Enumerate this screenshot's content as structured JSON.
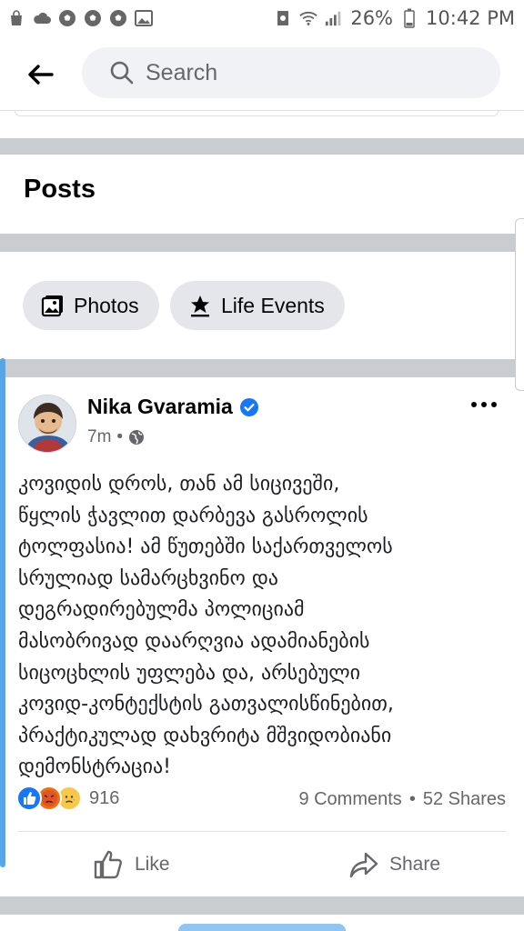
{
  "status_bar": {
    "battery": "26%",
    "time": "10:42 PM"
  },
  "header": {
    "search_placeholder": "Search"
  },
  "section": {
    "title": "Posts"
  },
  "chips": [
    {
      "label": "Photos",
      "icon": "photos-icon"
    },
    {
      "label": "Life Events",
      "icon": "star-flag-icon"
    }
  ],
  "post": {
    "author": "Nika Gvaramia",
    "time": "7m",
    "separator": "•",
    "text_lines": [
      "კოვიდის დროს, თან ამ სიცივეში,",
      "წყლის ჭავლით დარბევა გასროლის",
      "ტოლფასია! ამ წუთებში საქართველოს",
      "სრულიად სამარცხვინო და",
      "დეგრადირებულმა პოლიციამ",
      "მასობრივად დაარღვია ადამიანების",
      "სიცოცხლის უფლება და, არსებული",
      "კოვიდ-კონტექსტის გათვალისწინებით,",
      "პრაქტიკულად დახვრიტა მშვიდობიანი",
      "დემონსტრაცია!"
    ],
    "reaction_count": "916",
    "comments": "9 Comments",
    "dot": "•",
    "shares": "52 Shares",
    "like_label": "Like",
    "share_label": "Share"
  },
  "colors": {
    "accent": "#1877f2",
    "divider": "#c9ccd1",
    "chip_bg": "#e4e6eb",
    "secondary_text": "#65676b"
  }
}
